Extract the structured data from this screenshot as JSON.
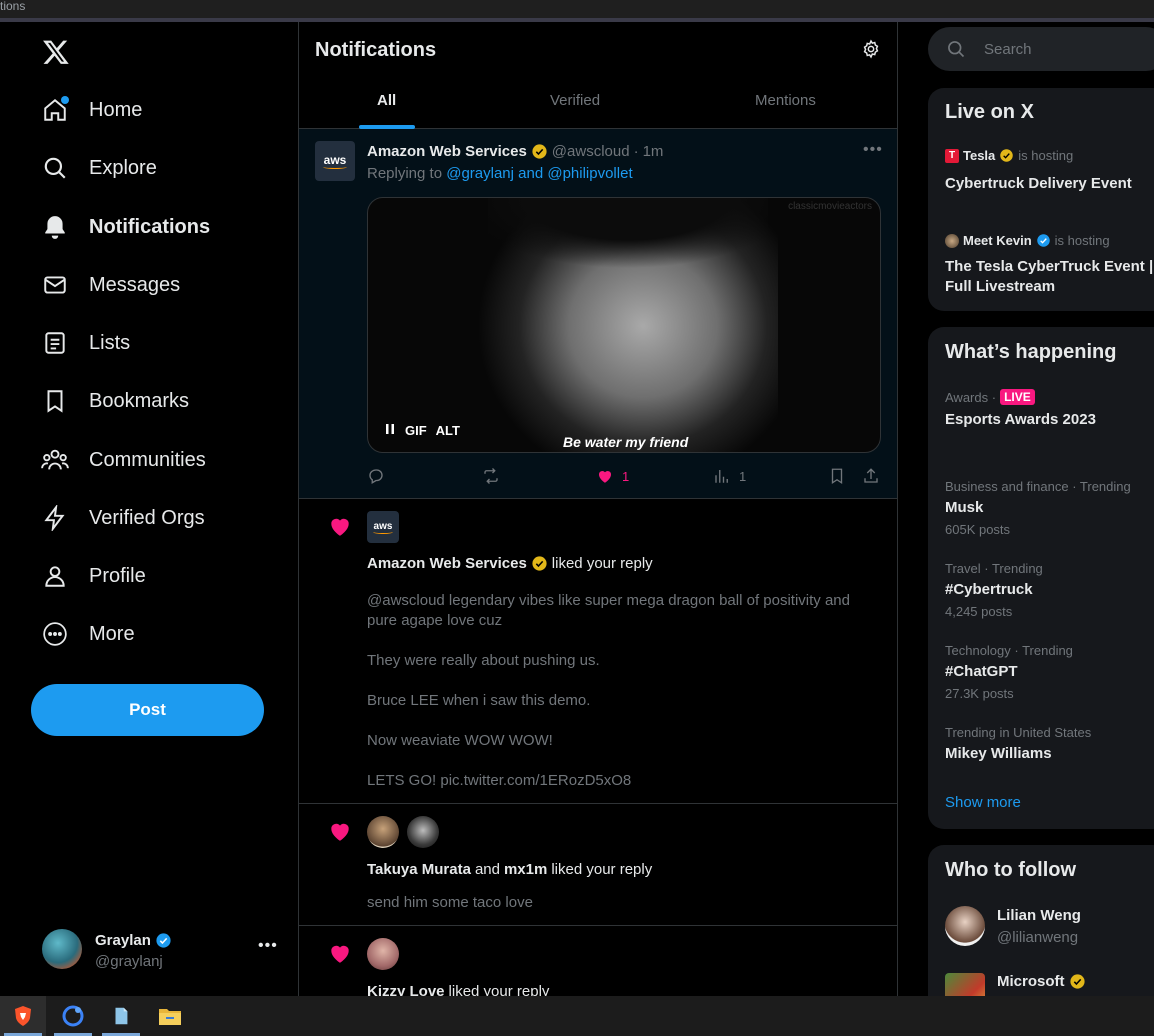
{
  "browser": {
    "tab_fragment": "tions"
  },
  "nav": {
    "items": [
      {
        "label": "Home",
        "icon": "home-icon"
      },
      {
        "label": "Explore",
        "icon": "search-icon"
      },
      {
        "label": "Notifications",
        "icon": "bell-icon"
      },
      {
        "label": "Messages",
        "icon": "envelope-icon"
      },
      {
        "label": "Lists",
        "icon": "list-icon"
      },
      {
        "label": "Bookmarks",
        "icon": "bookmark-icon"
      },
      {
        "label": "Communities",
        "icon": "communities-icon"
      },
      {
        "label": "Verified Orgs",
        "icon": "lightning-icon"
      },
      {
        "label": "Profile",
        "icon": "person-icon"
      },
      {
        "label": "More",
        "icon": "more-circle-icon"
      }
    ],
    "post_label": "Post"
  },
  "account": {
    "name": "Graylan",
    "handle": "@graylanj"
  },
  "main": {
    "title": "Notifications",
    "tabs": [
      {
        "label": "All"
      },
      {
        "label": "Verified"
      },
      {
        "label": "Mentions"
      }
    ]
  },
  "tweet": {
    "author": "Amazon Web Services",
    "handle": "@awscloud",
    "time": "1m",
    "replying_prefix": "Replying to",
    "replying_to": "@graylanj and @philipvollet",
    "media": {
      "watermark": "classicmovieactors",
      "caption": "Be water my friend",
      "gif_label": "GIF",
      "alt_label": "ALT"
    },
    "likes": "1",
    "views": "1",
    "avatar_text": "aws"
  },
  "notifications": [
    {
      "actor": "Amazon Web Services",
      "action": "liked your reply",
      "lines": [
        "@awscloud legendary vibes like super mega dragon ball of positivity and pure agape love cuz",
        "They were really about pushing us.",
        "Bruce LEE when i saw this demo.",
        "Now weaviate  WOW WOW!",
        "LETS GO! pic.twitter.com/1ERozD5xO8"
      ]
    },
    {
      "actor": "Takuya Murata",
      "conjunction": "and",
      "actor2": "mx1m",
      "action": "liked your reply",
      "lines": [
        "send him some taco love"
      ]
    },
    {
      "actor": "Kizzy Love",
      "action": "liked your reply"
    }
  ],
  "right": {
    "search_placeholder": "Search",
    "live": {
      "title": "Live on X",
      "events": [
        {
          "host": "Tesla",
          "hosting": "is hosting",
          "title": "Cybertruck Delivery Event"
        },
        {
          "host": "Meet Kevin",
          "hosting": "is hosting",
          "title": "The Tesla CyberTruck Event | Full Livestream"
        }
      ]
    },
    "happening": {
      "title": "What’s happening",
      "live_meta": "Awards ·",
      "live_badge": "LIVE",
      "live_title": "Esports Awards 2023",
      "trends": [
        {
          "meta": "Business and finance · Trending",
          "title": "Musk",
          "posts": "605K posts"
        },
        {
          "meta": "Travel · Trending",
          "title": "#Cybertruck",
          "posts": "4,245 posts"
        },
        {
          "meta": "Technology · Trending",
          "title": "#ChatGPT",
          "posts": "27.3K posts"
        },
        {
          "meta": "Trending in United States",
          "title": "Mikey Williams",
          "posts": ""
        }
      ],
      "show_more": "Show more"
    },
    "who_to_follow": {
      "title": "Who to follow",
      "users": [
        {
          "name": "Lilian Weng",
          "handle": "@lilianweng"
        },
        {
          "name": "Microsoft",
          "handle": ""
        }
      ]
    }
  },
  "colors": {
    "accent": "#1d9bf0",
    "like": "#f91880",
    "verified_gold": "#e2b719",
    "background": "#000000"
  }
}
